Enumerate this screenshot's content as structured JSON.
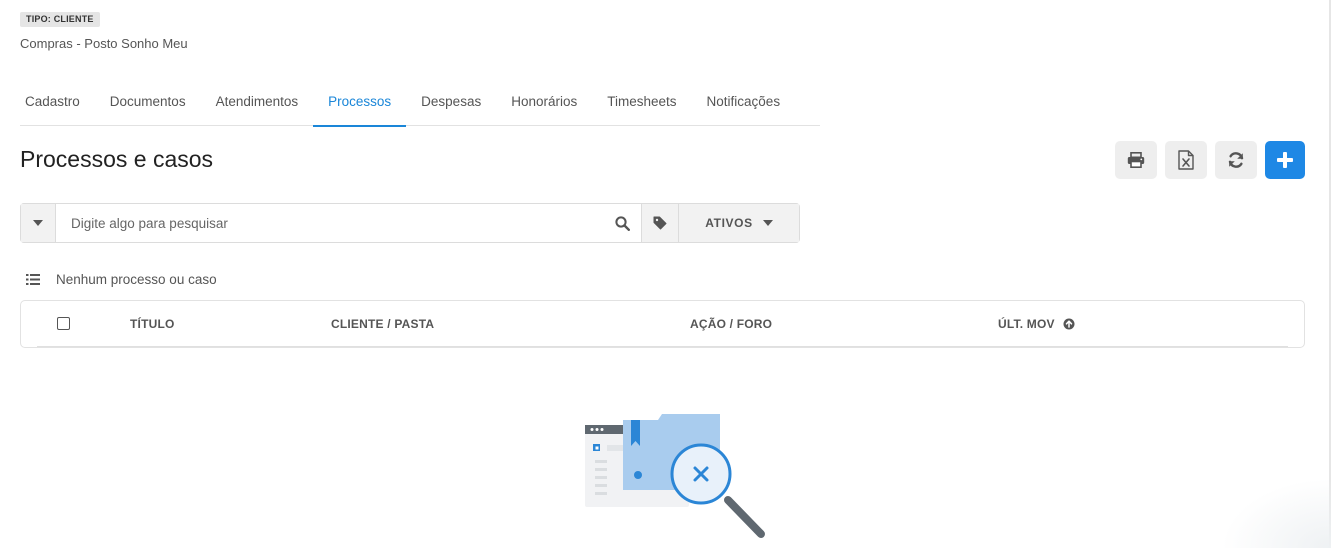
{
  "header": {
    "type_badge": "TIPO: CLIENTE",
    "client_name": "Compras - Posto Sonho Meu"
  },
  "tabs": [
    {
      "label": "Cadastro",
      "active": false
    },
    {
      "label": "Documentos",
      "active": false
    },
    {
      "label": "Atendimentos",
      "active": false
    },
    {
      "label": "Processos",
      "active": true
    },
    {
      "label": "Despesas",
      "active": false
    },
    {
      "label": "Honorários",
      "active": false
    },
    {
      "label": "Timesheets",
      "active": false
    },
    {
      "label": "Notificações",
      "active": false
    }
  ],
  "page": {
    "title": "Processos e casos"
  },
  "toolbar": {
    "buttons": [
      {
        "icon": "print-icon"
      },
      {
        "icon": "excel-icon"
      },
      {
        "icon": "refresh-icon"
      },
      {
        "icon": "plus-icon"
      }
    ]
  },
  "search": {
    "placeholder": "Digite algo para pesquisar",
    "value": "",
    "filter_label": "ATIVOS"
  },
  "list": {
    "count_text": "Nenhum processo ou caso"
  },
  "table": {
    "columns": [
      "TÍTULO",
      "CLIENTE / PASTA",
      "AÇÃO / FORO",
      "ÚLT. MOV"
    ],
    "rows": []
  },
  "colors": {
    "accent": "#1a86d8",
    "primary_button": "#1e88e5",
    "illustration_blue": "#a9ccee"
  }
}
